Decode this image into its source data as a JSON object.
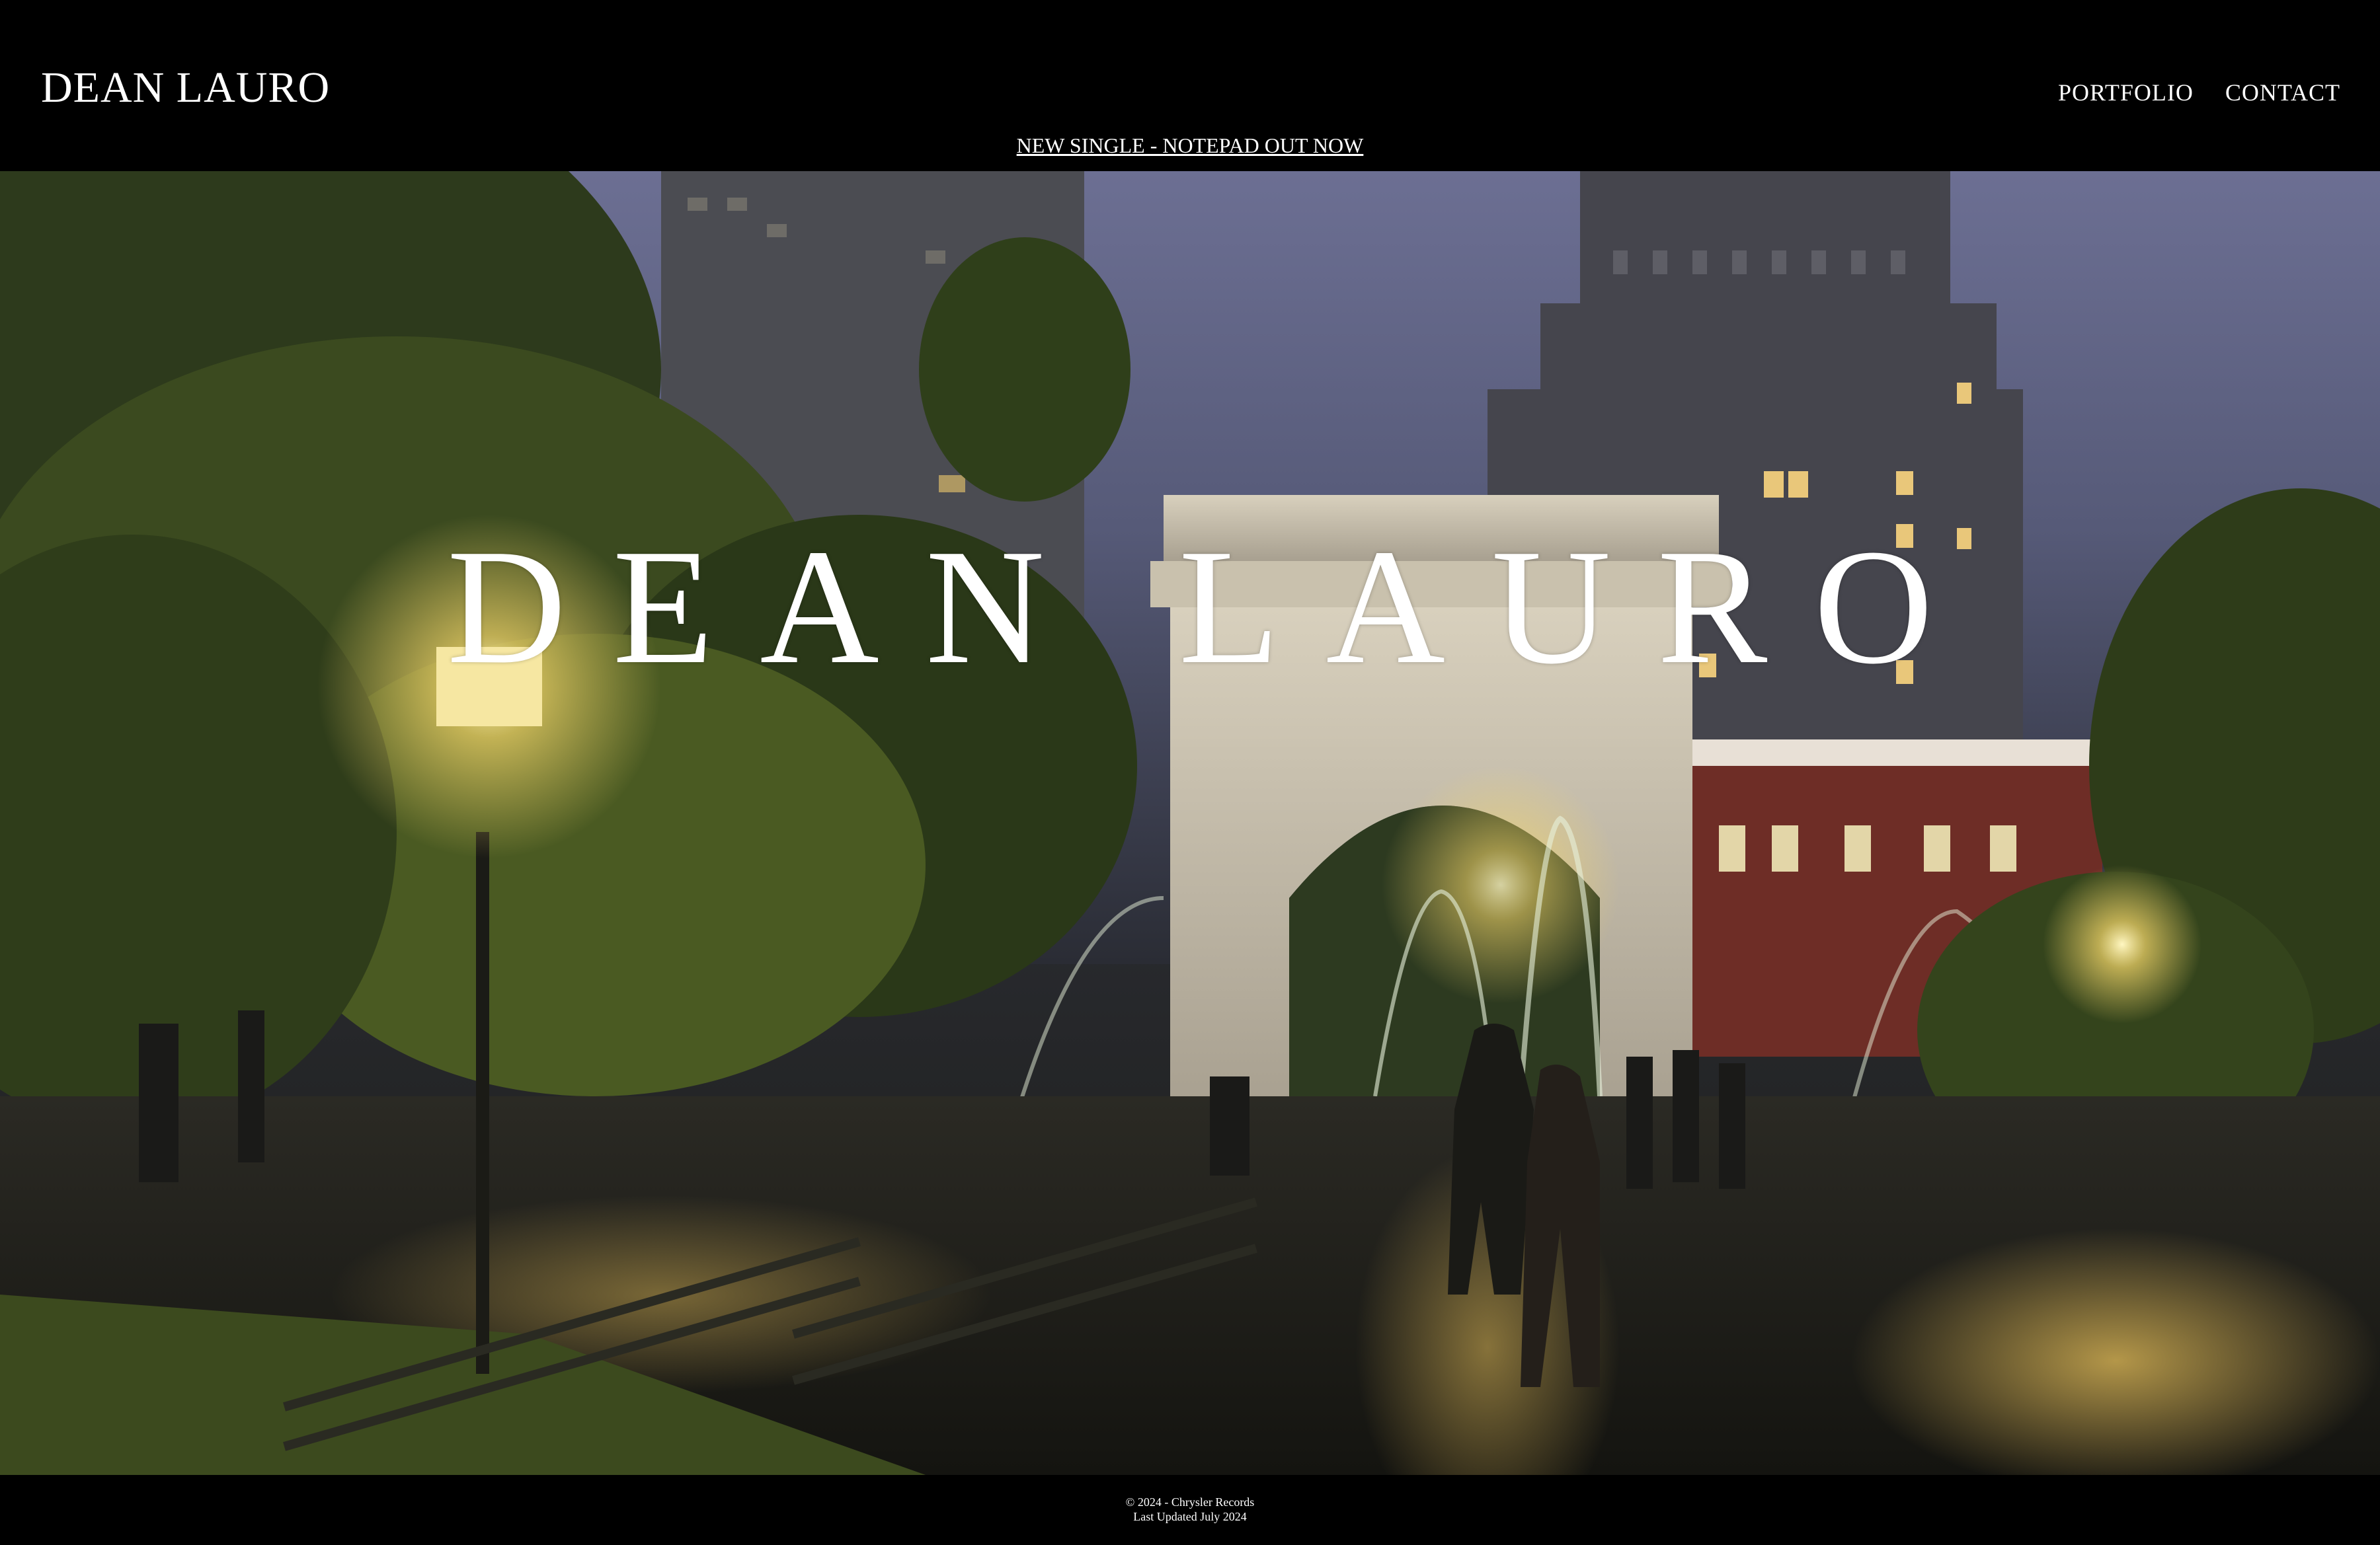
{
  "header": {
    "logo_text": "DEAN LAURO",
    "nav": [
      {
        "label": "PORTFOLIO"
      },
      {
        "label": "CONTACT"
      }
    ],
    "announcement": "NEW SINGLE - NOTEPAD OUT NOW"
  },
  "hero": {
    "title": "DEAN LAURO",
    "image_alt": "Washington Square Park arch at night with fountain and couple kissing"
  },
  "footer": {
    "copyright": "© 2024 - Chrysler Records",
    "updated": "Last Updated July 2024"
  },
  "colors": {
    "background": "#000000",
    "text": "#ffffff"
  }
}
